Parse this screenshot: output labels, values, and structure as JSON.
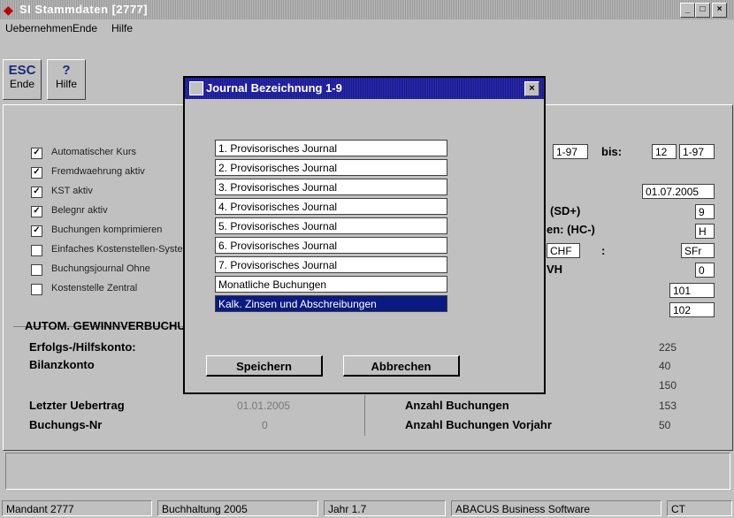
{
  "window": {
    "title": "SI Stammdaten [2777]",
    "min": "_",
    "max": "□",
    "close": "×"
  },
  "menu": [
    "Uebernehmen",
    "Ende",
    "Hilfe"
  ],
  "toolbar": {
    "esc_big": "ESC",
    "esc_small": "Ende",
    "help_big": "?",
    "help_small": "Hilfe"
  },
  "checkboxes": [
    {
      "label": "Automatischer Kurs",
      "checked": true
    },
    {
      "label": "Fremdwaehrung aktiv",
      "checked": true
    },
    {
      "label": "KST aktiv",
      "checked": true
    },
    {
      "label": "Belegnr aktiv",
      "checked": true
    },
    {
      "label": "Buchungen komprimieren",
      "checked": true
    },
    {
      "label": "Einfaches Kostenstellen-System",
      "checked": false
    },
    {
      "label": "Buchungsjournal Ohne",
      "checked": false
    },
    {
      "label": "Kostenstelle Zentral",
      "checked": false
    }
  ],
  "right_fields": {
    "period_from": "1-97",
    "bis_label": "bis:",
    "period_to_a": "12",
    "period_to_b": "1-97",
    "date": "01.07.2005",
    "sd_label": "(SD+)",
    "sd_value": "9",
    "hc_label": "en: (HC-)",
    "hc_value": "H",
    "chf_label": "CHF",
    "colon": ":",
    "chf_value": "SFr",
    "v_label": "VH",
    "v_value": "0",
    "f1": "101",
    "f2": "102"
  },
  "section": {
    "title": "AUTOM. GEWINNVERBUCHUNG",
    "erfolg_label": "Erfolgs-/Hilfskonto:",
    "bilanz_label": "Bilanzkonto",
    "uebertrag_label": "Letzter Uebertrag",
    "uebertrag_value": "01.01.2005",
    "buchnr_label": "Buchungs-Nr",
    "buchnr_value": "0",
    "right_val_1": "225",
    "right_val_2": "40",
    "right_val_3": "150",
    "anzahl_label": "Anzahl Buchungen",
    "anzahl_value": "153",
    "anzahl_vj_label": "Anzahl Buchungen Vorjahr",
    "anzahl_vj_value": "50"
  },
  "dialog": {
    "title": "Journal Bezeichnung 1-9",
    "close": "×",
    "journals": [
      "1. Provisorisches Journal",
      "2. Provisorisches Journal",
      "3. Provisorisches Journal",
      "4. Provisorisches Journal",
      "5. Provisorisches Journal",
      "6. Provisorisches Journal",
      "7. Provisorisches Journal",
      "Monatliche Buchungen",
      "Kalk. Zinsen und Abschreibungen"
    ],
    "selected_index": 8,
    "save": "Speichern",
    "cancel": "Abbrechen"
  },
  "status": [
    "Mandant 2777",
    "Buchhaltung 2005",
    "Jahr 1.7",
    "ABACUS Business Software",
    "CT"
  ],
  "colors": {
    "dialog_title": "#1a1a8a",
    "selection": "#0a1a80",
    "help_text": "#1a2a7a"
  }
}
